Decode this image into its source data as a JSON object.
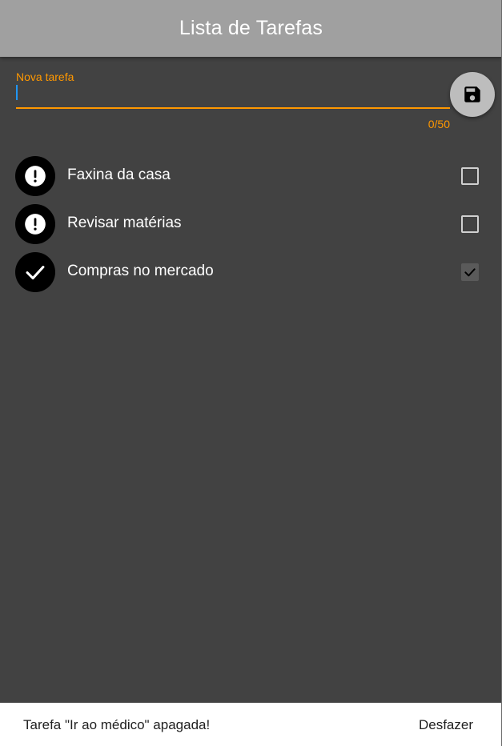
{
  "appbar": {
    "title": "Lista de Tarefas"
  },
  "new_task": {
    "label": "Nova tarefa",
    "value": "",
    "counter": "0/50",
    "accent_color": "#ff9800",
    "save_icon": "save-icon"
  },
  "tasks": [
    {
      "label": "Faxina da casa",
      "done": false,
      "icon": "exclamation-icon"
    },
    {
      "label": "Revisar matérias",
      "done": false,
      "icon": "exclamation-icon"
    },
    {
      "label": "Compras no mercado",
      "done": true,
      "icon": "check-icon"
    }
  ],
  "snackbar": {
    "message": "Tarefa \"Ir ao médico\" apagada!",
    "action": "Desfazer"
  },
  "colors": {
    "background": "#424242",
    "appbar": "#a0a0a0",
    "avatar": "#000000"
  }
}
